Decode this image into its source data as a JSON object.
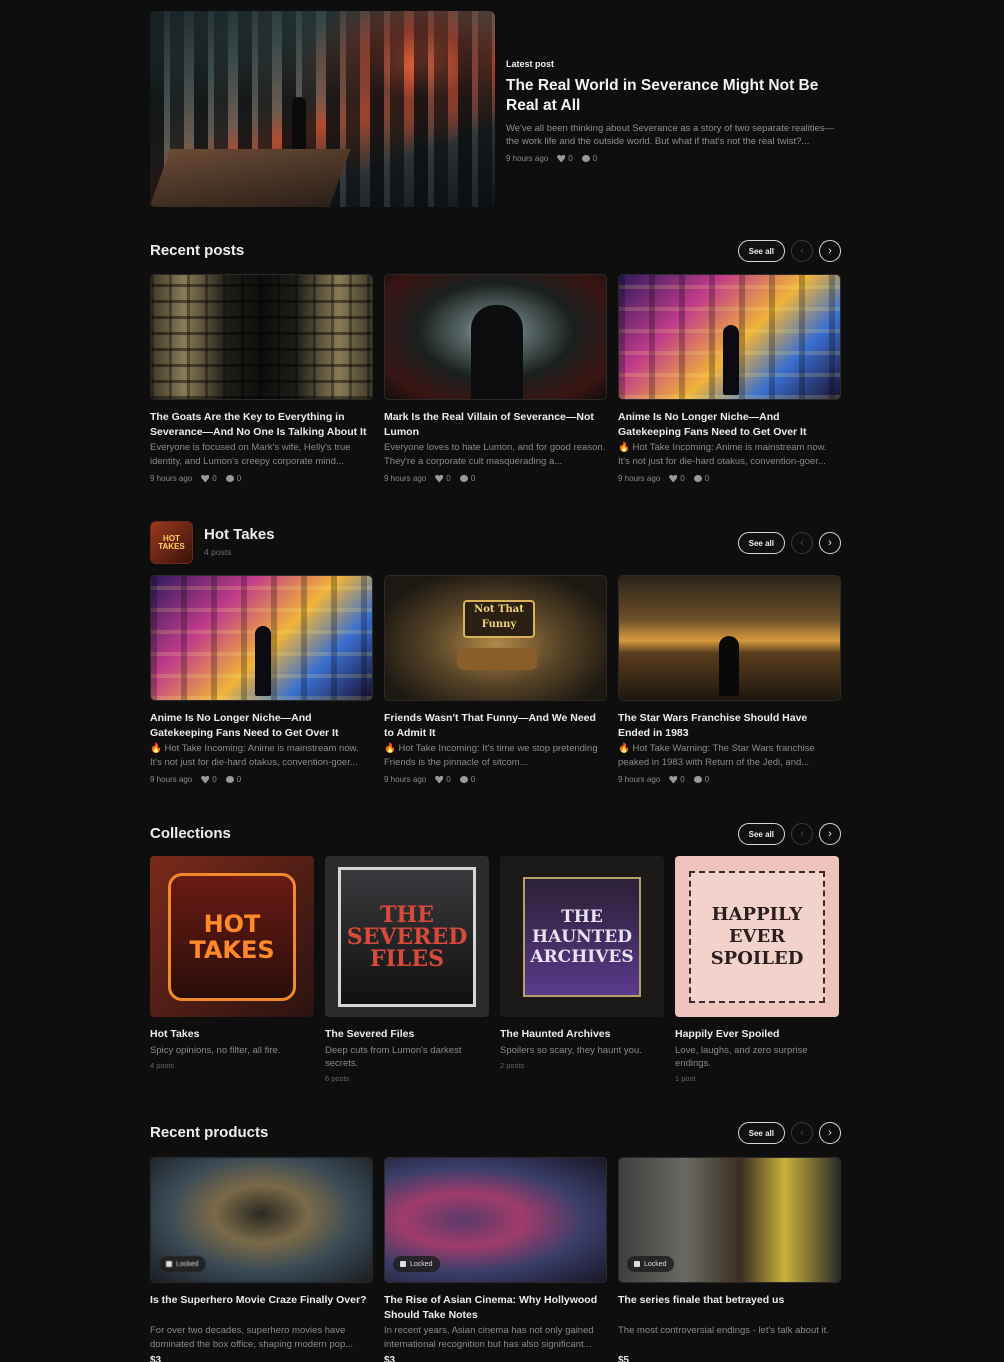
{
  "hero": {
    "eyebrow": "Latest post",
    "title": "The Real World in Severance Might Not Be Real at All",
    "description": "We've all been thinking about Severance as a story of two separate realities—the work life and the outside world. But what if that's not the real twist?...",
    "time": "9 hours ago",
    "likes": "0",
    "comments": "0"
  },
  "recent_posts": {
    "title": "Recent posts",
    "see_all": "See all",
    "items": [
      {
        "title": "The Goats Are the Key to Everything in Severance—And No One Is Talking About It",
        "description": "Everyone is focused on Mark's wife, Helly's true identity, and Lumon's creepy corporate mind...",
        "time": "9 hours ago",
        "likes": "0",
        "comments": "0"
      },
      {
        "title": "Mark Is the Real Villain of Severance—Not Lumon",
        "description": "Everyone loves to hate Lumon, and for good reason. They're a corporate cult masquerading a...",
        "time": "9 hours ago",
        "likes": "0",
        "comments": "0"
      },
      {
        "title": "Anime Is No Longer Niche—And Gatekeeping Fans Need to Get Over It",
        "description": "🔥 Hot Take Incoming: Anime is mainstream now. It's not just for die-hard otakus, convention-goer...",
        "time": "9 hours ago",
        "likes": "0",
        "comments": "0"
      }
    ]
  },
  "hot_takes": {
    "logo_text": "HOT TAKES",
    "name": "Hot Takes",
    "count": "4 posts",
    "see_all": "See all",
    "items": [
      {
        "title": "Anime Is No Longer Niche—And Gatekeeping Fans Need to Get Over It",
        "description": "🔥 Hot Take Incoming: Anime is mainstream now. It's not just for die-hard otakus, convention-goer...",
        "time": "9 hours ago",
        "likes": "0",
        "comments": "0"
      },
      {
        "title": "Friends Wasn't That Funny—And We Need to Admit It",
        "description": "🔥 Hot Take Incoming: It's time we stop pretending Friends is the pinnacle of sitcom...",
        "time": "9 hours ago",
        "likes": "0",
        "comments": "0"
      },
      {
        "title": "The Star Wars Franchise Should Have Ended in 1983",
        "description": "🔥 Hot Take Warning: The Star Wars franchise peaked in 1983 with Return of the Jedi, and...",
        "time": "9 hours ago",
        "likes": "0",
        "comments": "0"
      }
    ]
  },
  "collections": {
    "title": "Collections",
    "see_all": "See all",
    "items": [
      {
        "art": "HOT TAKES",
        "title": "Hot Takes",
        "description": "Spicy opinions, no filter, all fire.",
        "count": "4 posts"
      },
      {
        "art": "THE SEVERED FILES",
        "title": "The Severed Files",
        "description": "Deep cuts from Lumon's darkest secrets.",
        "count": "6 posts"
      },
      {
        "art": "THE HAUNTED ARCHIVES",
        "title": "The Haunted Archives",
        "description": "Spoilers so scary, they haunt you.",
        "count": "2 posts"
      },
      {
        "art": "HAPPILY EVER SPOILED",
        "title": "Happily Ever Spoiled",
        "description": "Love, laughs, and zero surprise endings.",
        "count": "1 post"
      }
    ]
  },
  "recent_products": {
    "title": "Recent products",
    "see_all": "See all",
    "locked_label": "Locked",
    "items": [
      {
        "title": "Is the Superhero Movie Craze Finally Over?",
        "description": "For over two decades, superhero movies have dominated the box office, shaping modern pop...",
        "price": "$3"
      },
      {
        "title": "The Rise of Asian Cinema: Why Hollywood Should Take Notes",
        "description": "In recent years, Asian cinema has not only gained international recognition but has also significant...",
        "price": "$3"
      },
      {
        "title": "The series finale that betrayed us",
        "description": "The most controversial endings - let's talk about it.",
        "price": "$5"
      }
    ]
  }
}
